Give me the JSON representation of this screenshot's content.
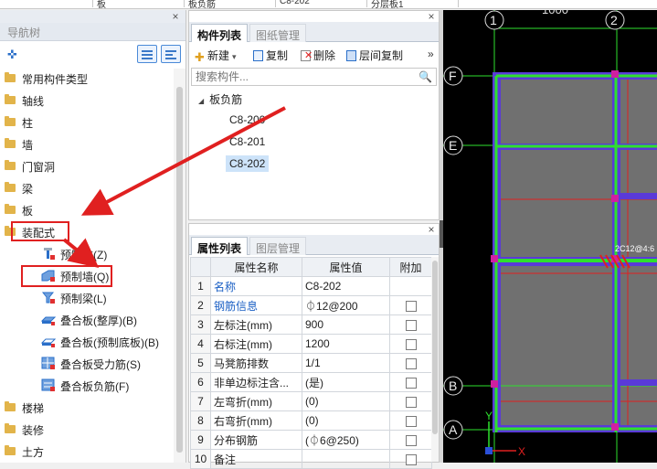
{
  "top_bar": {
    "cells": [
      "",
      "板",
      "板负筋",
      "C8-202",
      "分层板1"
    ]
  },
  "nav": {
    "title": "导航树",
    "close": "×",
    "items": [
      {
        "label": "常用构件类型"
      },
      {
        "label": "轴线"
      },
      {
        "label": "柱"
      },
      {
        "label": "墙"
      },
      {
        "label": "门窗洞"
      },
      {
        "label": "梁"
      },
      {
        "label": "板"
      },
      {
        "label": "装配式"
      }
    ],
    "sub_items": [
      {
        "label": "预制柱(Z)"
      },
      {
        "label": "预制墙(Q)"
      },
      {
        "label": "预制梁(L)"
      },
      {
        "label": "叠合板(整厚)(B)"
      },
      {
        "label": "叠合板(预制底板)(B)"
      },
      {
        "label": "叠合板受力筋(S)"
      },
      {
        "label": "叠合板负筋(F)"
      }
    ],
    "items_after": [
      {
        "label": "楼梯"
      },
      {
        "label": "装修"
      },
      {
        "label": "土方"
      }
    ]
  },
  "component_panel": {
    "tabs": [
      "构件列表",
      "图纸管理"
    ],
    "close": "×",
    "toolbar": {
      "new": "新建",
      "copy": "复制",
      "delete": "删除",
      "floor_copy": "层间复制",
      "more": "»"
    },
    "search_placeholder": "搜索构件...",
    "tree": {
      "root": "板负筋",
      "children": [
        "C8-200",
        "C8-201",
        "C8-202"
      ],
      "selected": "C8-202"
    }
  },
  "properties_panel": {
    "tabs": [
      "属性列表",
      "图层管理"
    ],
    "close": "×",
    "columns": [
      "",
      "属性名称",
      "属性值",
      "附加"
    ],
    "rows": [
      {
        "num": "1",
        "name": "名称",
        "value": "C8-202",
        "blue": true,
        "has_check": false
      },
      {
        "num": "2",
        "name": "钢筋信息",
        "value": "⏀12@200",
        "blue": true,
        "has_check": true
      },
      {
        "num": "3",
        "name": "左标注(mm)",
        "value": "900",
        "blue": false,
        "has_check": true
      },
      {
        "num": "4",
        "name": "右标注(mm)",
        "value": "1200",
        "blue": false,
        "has_check": true
      },
      {
        "num": "5",
        "name": "马凳筋排数",
        "value": "1/1",
        "blue": false,
        "has_check": true
      },
      {
        "num": "6",
        "name": "非单边标注含...",
        "value": "(是)",
        "blue": false,
        "has_check": true
      },
      {
        "num": "7",
        "name": "左弯折(mm)",
        "value": "(0)",
        "blue": false,
        "has_check": true
      },
      {
        "num": "8",
        "name": "右弯折(mm)",
        "value": "(0)",
        "blue": false,
        "has_check": true
      },
      {
        "num": "9",
        "name": "分布钢筋",
        "value": "(⏀6@250)",
        "blue": false,
        "has_check": true
      },
      {
        "num": "10",
        "name": "备注",
        "value": "",
        "blue": false,
        "has_check": true
      }
    ]
  },
  "canvas": {
    "dimension": "1000",
    "axis_labels": [
      "1",
      "2",
      "F",
      "E",
      "B",
      "A"
    ],
    "rebar_label": "2C12@4:6",
    "x_axis": "X",
    "y_axis": "Y"
  },
  "colors": {
    "accent": "#1a5fc4",
    "highlight_red": "#e02020",
    "wall": "#5a3ad8",
    "rebar": "#2ee02e",
    "slab": "#707070"
  }
}
